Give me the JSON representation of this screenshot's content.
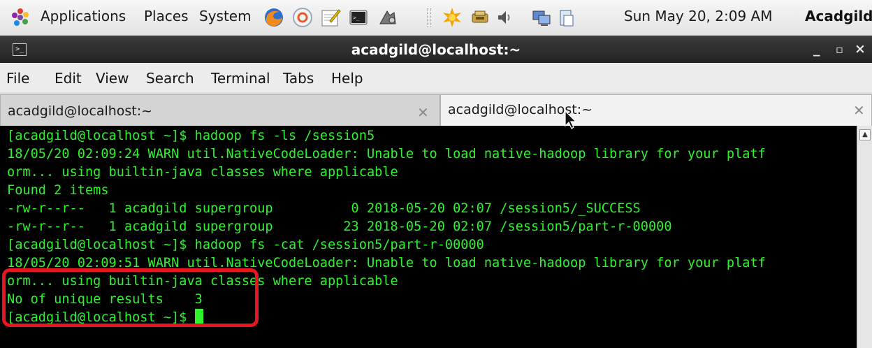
{
  "panel": {
    "menus": [
      "Applications",
      "Places",
      "System"
    ],
    "clock": "Sun May 20,  2:09 AM",
    "user": "Acadgild"
  },
  "window": {
    "title": "acadgild@localhost:~",
    "minimize": "_",
    "maximize": "▫",
    "close": "×"
  },
  "menubar": [
    "File",
    "Edit",
    "View",
    "Search",
    "Terminal",
    "Tabs",
    "Help"
  ],
  "tabs": [
    {
      "label": "acadgild@localhost:~",
      "close": "✕",
      "active": false
    },
    {
      "label": "acadgild@localhost:~",
      "close": "✕",
      "active": true
    }
  ],
  "terminal": {
    "lines": [
      "[acadgild@localhost ~]$ hadoop fs -ls /session5",
      "18/05/20 02:09:24 WARN util.NativeCodeLoader: Unable to load native-hadoop library for your platf",
      "orm... using builtin-java classes where applicable",
      "Found 2 items",
      "-rw-r--r--   1 acadgild supergroup          0 2018-05-20 02:07 /session5/_SUCCESS",
      "-rw-r--r--   1 acadgild supergroup         23 2018-05-20 02:07 /session5/part-r-00000",
      "[acadgild@localhost ~]$ hadoop fs -cat /session5/part-r-00000",
      "18/05/20 02:09:51 WARN util.NativeCodeLoader: Unable to load native-hadoop library for your platf",
      "orm... using builtin-java classes where applicable",
      "No of unique results    3",
      "[acadgild@localhost ~]$ "
    ],
    "text_color": "#2ff22f",
    "background": "#000000"
  },
  "colors": {
    "annotation": "#e8161f",
    "titlebar": "#2b2b2b"
  },
  "icons": [
    "apps-icon",
    "firefox-icon",
    "help-icon",
    "text-editor-icon",
    "terminal-icon",
    "screenshot-icon",
    "update-icon",
    "network-icon",
    "volume-icon",
    "display-icon",
    "clipboard-icon"
  ]
}
